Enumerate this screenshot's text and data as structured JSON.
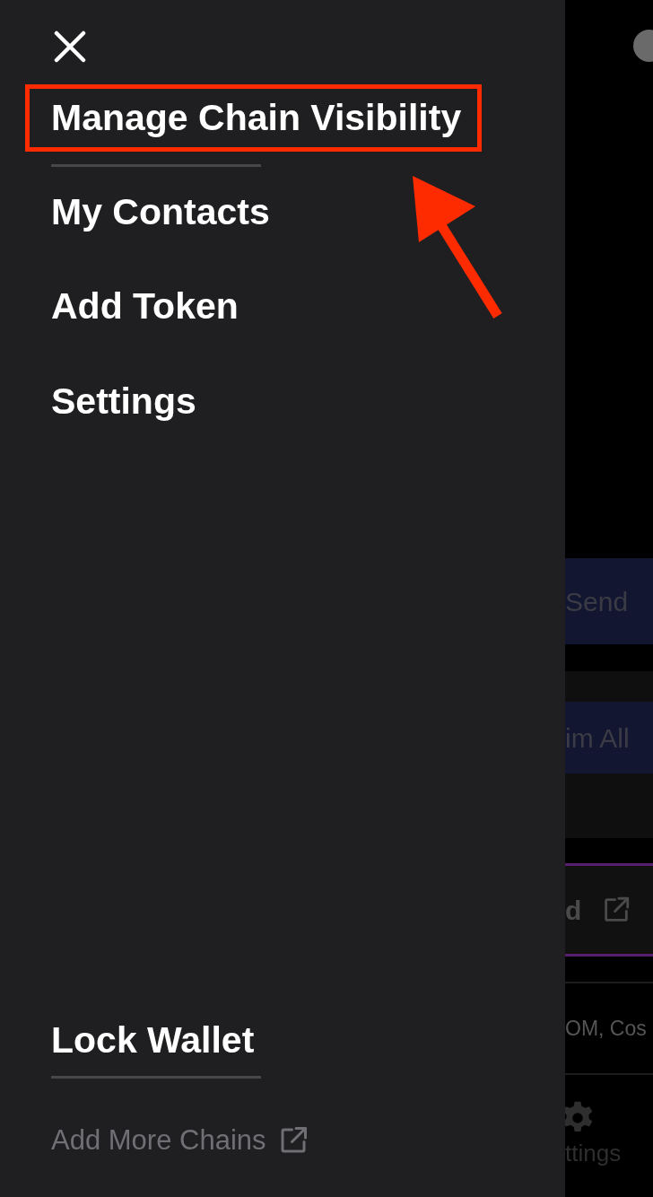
{
  "drawer": {
    "items": [
      {
        "label": "Manage Chain Visibility",
        "highlighted": true,
        "divider_after": true
      },
      {
        "label": "My Contacts",
        "highlighted": false,
        "divider_after": false
      },
      {
        "label": "Add Token",
        "highlighted": false,
        "divider_after": false
      },
      {
        "label": "Settings",
        "highlighted": false,
        "divider_after": false
      }
    ],
    "lock_label": "Lock Wallet",
    "more_link": "Add More Chains"
  },
  "background": {
    "send_button": "Send",
    "claim_button": "im All",
    "link_row": "d",
    "networks_text": "OM, Cos",
    "nav_label": "ttings"
  }
}
